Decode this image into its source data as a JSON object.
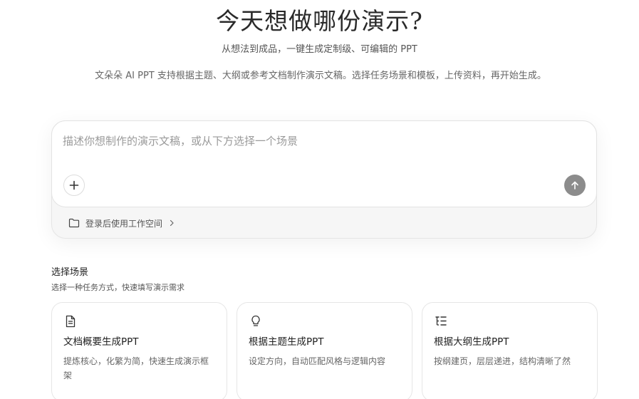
{
  "hero": {
    "title": "今天想做哪份演示?",
    "subtitle": "从想法到成品，一键生成定制级、可编辑的 PPT",
    "description": "文朵朵 AI PPT 支持根据主题、大纲或参考文档制作演示文稿。选择任务场景和模板，上传资料，再开始生成。"
  },
  "composer": {
    "placeholder": "描述你想制作的演示文稿，或从下方选择一个场景",
    "add_icon": "plus-icon",
    "send_icon": "arrow-up-icon",
    "workspace_label": "登录后使用工作空间"
  },
  "scenes": {
    "title": "选择场景",
    "subtitle": "选择一种任务方式，快速填写演示需求",
    "cards": [
      {
        "icon": "document-icon",
        "title": "文档概要生成PPT",
        "description": "提炼核心，化繁为简，快速生成演示框架"
      },
      {
        "icon": "lightbulb-icon",
        "title": "根据主题生成PPT",
        "description": "设定方向，自动匹配风格与逻辑内容"
      },
      {
        "icon": "outline-list-icon",
        "title": "根据大纲生成PPT",
        "description": "按纲建页，层层递进，结构清晰了然"
      }
    ]
  },
  "colors": {
    "send_button": "#8c8c8c",
    "composer_footer": "#f6f6f6",
    "card_border": "#e6e6e6"
  }
}
